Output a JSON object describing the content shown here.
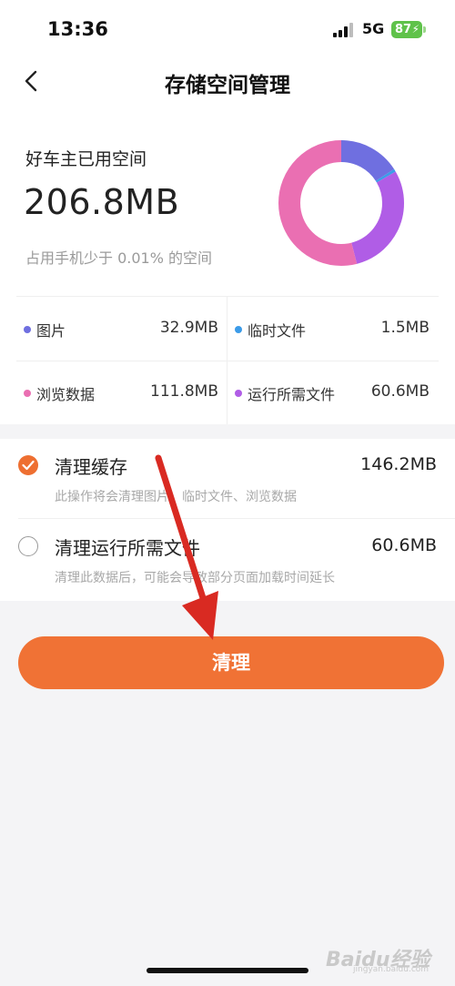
{
  "status_bar": {
    "time": "13:36",
    "network": "5G",
    "battery": "87"
  },
  "nav": {
    "title": "存储空间管理"
  },
  "storage": {
    "used_label": "好车主已用空间",
    "used_value": "206.8MB",
    "note": "占用手机少于 0.01% 的空间"
  },
  "breakdown": [
    {
      "label": "图片",
      "size": "32.9MB",
      "color": "#6f6fe0"
    },
    {
      "label": "临时文件",
      "size": "1.5MB",
      "color": "#3b9be8"
    },
    {
      "label": "浏览数据",
      "size": "111.8MB",
      "color": "#ea6fb2"
    },
    {
      "label": "运行所需文件",
      "size": "60.6MB",
      "color": "#b05de6"
    }
  ],
  "options": [
    {
      "title": "清理缓存",
      "size": "146.2MB",
      "desc": "此操作将会清理图片、临时文件、浏览数据",
      "checked": true
    },
    {
      "title": "清理运行所需文件",
      "size": "60.6MB",
      "desc": "清理此数据后，可能会导致部分页面加载时间延长",
      "checked": false
    }
  ],
  "action": {
    "label": "清理"
  },
  "colors": {
    "accent": "#f07235",
    "arrow": "#d92a22"
  },
  "watermark": {
    "text": "Baidu经验",
    "sub": "jingyan.baidu.com"
  }
}
